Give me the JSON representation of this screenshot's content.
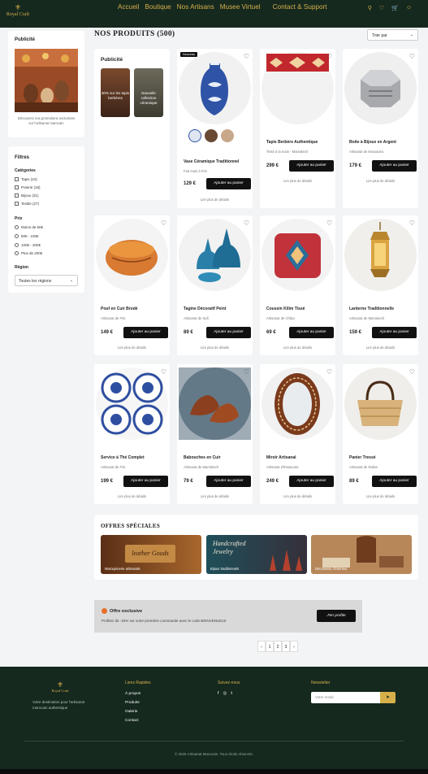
{
  "brand": {
    "name": "Royal Craft",
    "gold": "#d8b04a",
    "dark_green": "#15291f"
  },
  "nav": {
    "links": [
      "Accueil",
      "Boutique",
      "Nos Artisans",
      "Musee Virtuel",
      "Contact & Support"
    ],
    "icons": [
      "search-icon",
      "heart-icon",
      "cart-icon",
      "user-icon"
    ]
  },
  "sidebar": {
    "ad": {
      "title": "Publicité",
      "text": "Découvrez nos promotions exclusives sur l'artisanat marocain"
    },
    "filters": {
      "title": "Filtres",
      "categories_label": "Catégories",
      "categories": [
        "Tapis (24)",
        "Poterie (18)",
        "Bijoux (31)",
        "Textile (27)"
      ],
      "price_label": "Prix",
      "prices": [
        "Moins de 50€",
        "50€ - 100€",
        "100€ - 200€",
        "Plus de 200€"
      ],
      "region_label": "Région",
      "region_value": "Toutes les régions"
    }
  },
  "main": {
    "title": "Nos Produits (500)",
    "sort_value": "Trier par",
    "pub_card": {
      "title": "Publicité",
      "items": [
        "30% sur les tapis berbères",
        "Nouvelle collection céramique"
      ]
    },
    "badge_new": "Nouveau",
    "add_label": "Ajouter au panier",
    "more_label": "Lire plus de détails",
    "products": [
      {
        "name": "Vase Céramique Traditionnel",
        "artisan": "Fait main à Fès",
        "price": "129 €"
      },
      {
        "name": "Tapis Berbère Authentique",
        "artisan": "Tissé à la main - Marrakech",
        "price": "299 €"
      },
      {
        "name": "Boite à Bijoux en Argent",
        "artisan": "Artisanat de Essaouira",
        "price": "179 €"
      },
      {
        "name": "Pouf en Cuir Brodé",
        "artisan": "Artisanat de Fès",
        "price": "149 €"
      },
      {
        "name": "Tagine Décoratif Peint",
        "artisan": "Artisanat de Safi",
        "price": "89 €"
      },
      {
        "name": "Coussin Kilim Tissé",
        "artisan": "Artisanat de Chfaa",
        "price": "69 €"
      },
      {
        "name": "Lanterne Traditionnelle",
        "artisan": "Artisanat de Marrakech",
        "price": "159 €"
      },
      {
        "name": "Service à Thé Complet",
        "artisan": "Artisanat de Fès",
        "price": "199 €"
      },
      {
        "name": "Babouches en Cuir",
        "artisan": "Artisanat de Marrakech",
        "price": "79 €"
      },
      {
        "name": "Miroir Artisanal",
        "artisan": "Artisanat d'Essaouira",
        "price": "249 €"
      },
      {
        "name": "Panier Tressé",
        "artisan": "Artisanat de Rabat",
        "price": "89 €"
      }
    ],
    "offers": {
      "title": "Offres Spéciales",
      "items": [
        "Maroquinerie artisanale",
        "Bijoux traditionnels",
        "Décoration d'intérieur"
      ],
      "banner_texts": [
        "leather Goods",
        "Handcrafted Jewelry"
      ]
    },
    "promo": {
      "title": "Offre exclusive",
      "text": "Profitez de -15% sur votre première commande avec le code BIENVENUE15",
      "button": "J'en profite"
    },
    "pagination": [
      "‹",
      "1",
      "2",
      "3",
      "›"
    ]
  },
  "footer": {
    "brand": "Royal Craft",
    "description": "Votre destination pour l'artisanat marocain authentique",
    "quick_title": "Liens Rapides",
    "quick_links": [
      "À propos",
      "Produits",
      "Galerie",
      "Contact"
    ],
    "follow_title": "Suivez-nous",
    "social": [
      "f",
      "◎",
      "t"
    ],
    "newsletter_title": "Newsletter",
    "newsletter_placeholder": "Votre email",
    "newsletter_button": "➤",
    "copyright": "© 2025 Artisanat Marocain. Tous droits réservés."
  }
}
